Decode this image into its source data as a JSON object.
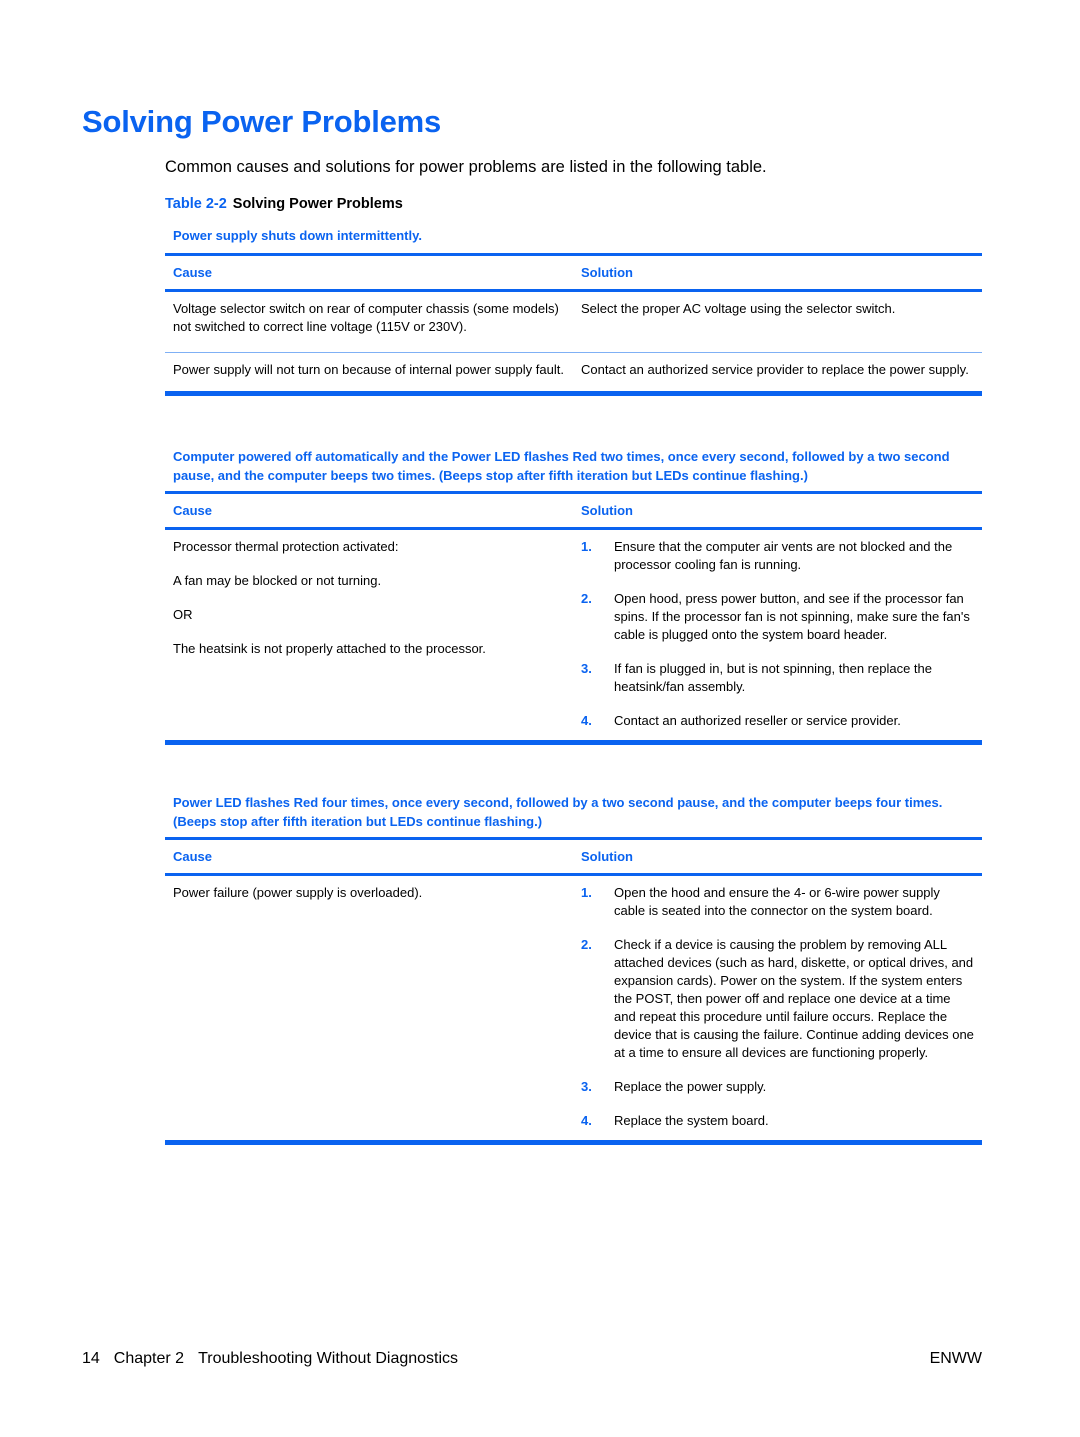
{
  "page": {
    "title": "Solving Power Problems",
    "intro": "Common causes and solutions for power problems are listed in the following table.",
    "table_caption_number": "Table 2-2",
    "table_caption_title": "Solving Power Problems"
  },
  "colors": {
    "accent": "#0a63f0",
    "thin_rule": "#7fb0f5"
  },
  "sections": [
    {
      "title": "Power supply shuts down intermittently.",
      "header_cause": "Cause",
      "header_solution": "Solution",
      "rows": [
        {
          "cause": [
            "Voltage selector switch on rear of computer chassis (some models) not switched to correct line voltage (115V or 230V)."
          ],
          "solution": "Select the proper AC voltage using the selector switch."
        },
        {
          "cause": [
            "Power supply will not turn on because of internal power supply fault."
          ],
          "solution": "Contact an authorized service provider to replace the power supply."
        }
      ]
    },
    {
      "title": "Computer powered off automatically and the Power LED flashes Red two times, once every second, followed by a two second pause, and the computer beeps two times. (Beeps stop after fifth iteration but LEDs continue flashing.)",
      "header_cause": "Cause",
      "header_solution": "Solution",
      "cause": [
        "Processor thermal protection activated:",
        "A fan may be blocked or not turning.",
        "OR",
        "The heatsink is not properly attached to the processor."
      ],
      "steps": [
        {
          "num": "1.",
          "text": "Ensure that the computer air vents are not blocked and the processor cooling fan is running."
        },
        {
          "num": "2.",
          "text": "Open hood, press power button, and see if the processor fan spins. If the processor fan is not spinning, make sure the fan's cable is plugged onto the system board header."
        },
        {
          "num": "3.",
          "text": "If fan is plugged in, but is not spinning, then replace the heatsink/fan assembly."
        },
        {
          "num": "4.",
          "text": "Contact an authorized reseller or service provider."
        }
      ]
    },
    {
      "title": "Power LED flashes Red four times, once every second, followed by a two second pause, and the computer beeps four times. (Beeps stop after fifth iteration but LEDs continue flashing.)",
      "header_cause": "Cause",
      "header_solution": "Solution",
      "cause": [
        "Power failure (power supply is overloaded)."
      ],
      "steps": [
        {
          "num": "1.",
          "text": "Open the hood and ensure the 4- or 6-wire power supply cable is seated into the connector on the system board."
        },
        {
          "num": "2.",
          "text": "Check if a device is causing the problem by removing ALL attached devices (such as hard, diskette, or optical drives, and expansion cards). Power on the system. If the system enters the POST, then power off and replace one device at a time and repeat this procedure until failure occurs. Replace the device that is causing the failure. Continue adding devices one at a time to ensure all devices are functioning properly."
        },
        {
          "num": "3.",
          "text": "Replace the power supply."
        },
        {
          "num": "4.",
          "text": "Replace the system board."
        }
      ]
    }
  ],
  "footer": {
    "page_number": "14",
    "chapter": "Chapter 2",
    "chapter_title": "Troubleshooting Without Diagnostics",
    "locale": "ENWW"
  }
}
